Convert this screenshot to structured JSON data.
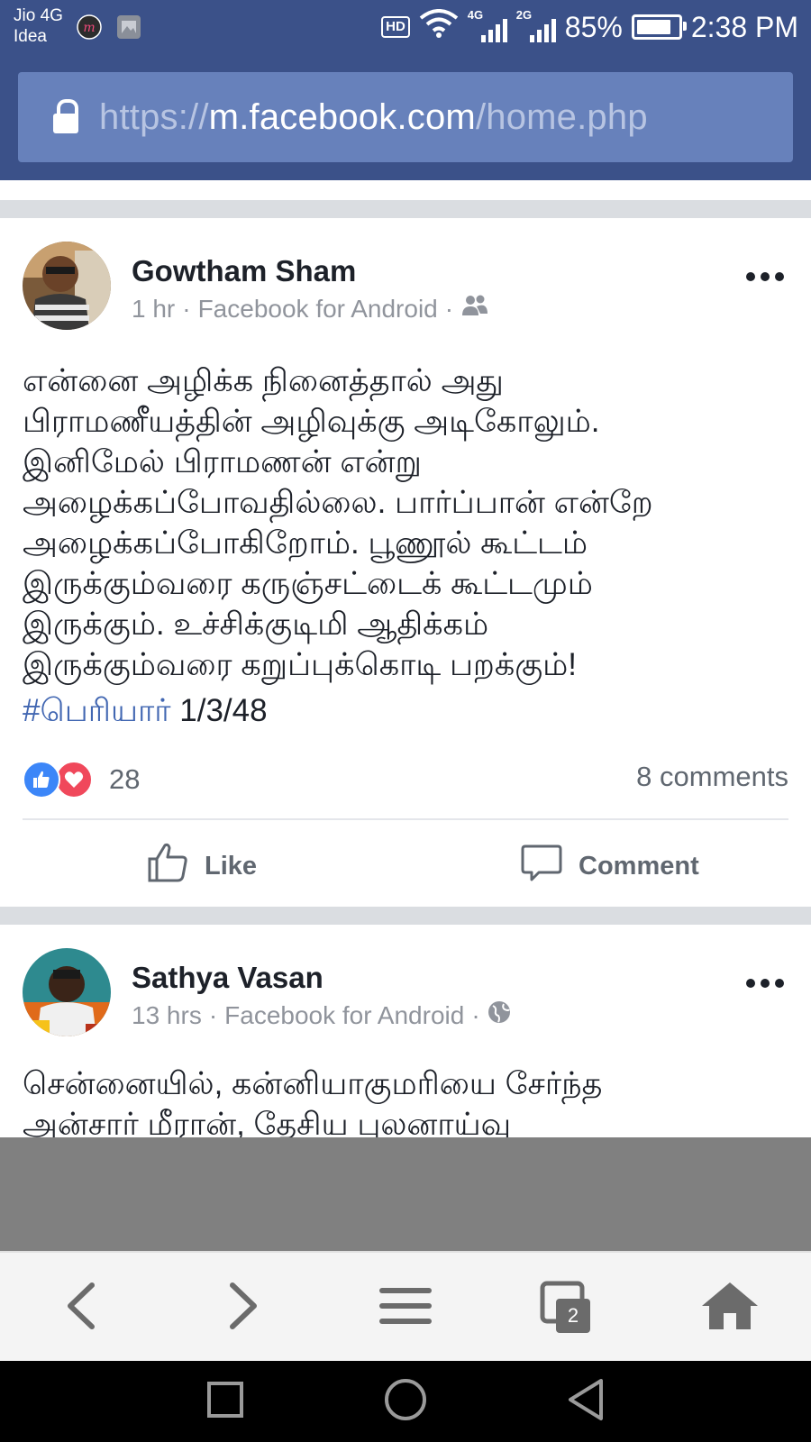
{
  "status_bar": {
    "carrier_line1": "Jio 4G",
    "carrier_line2": "Idea",
    "hd": "HD",
    "sim1_network": "4G",
    "sim2_network": "2G",
    "battery_percent_label": "85%",
    "battery_level": 0.85,
    "time": "2:38 PM",
    "icons": [
      "messenger-icon",
      "gallery-icon",
      "wifi-icon",
      "signal-icon",
      "battery-icon"
    ]
  },
  "browser": {
    "url_scheme": "https://",
    "url_host": "m.facebook.com",
    "url_path": "/home.php",
    "tab_count": "2",
    "accent": "#3b5189"
  },
  "posts": [
    {
      "author": "Gowtham Sham",
      "time": "1 hr",
      "source": "Facebook for Android",
      "audience_icon": "friends-icon",
      "lines": [
        "என்னை அழிக்க நினைத்தால் அது",
        "பிராமணீயத்தின் அழிவுக்கு அடிகோலும்.",
        "இனிமேல் பிராமணன் என்று",
        "அழைக்கப்போவதில்லை. பார்ப்பான் என்றே",
        "அழைக்கப்போகிறோம். பூணூல் கூட்டம்",
        "இருக்கும்வரை கருஞ்சட்டைக் கூட்டமும்",
        "இருக்கும். உச்சிக்குடிமி ஆதிக்கம்",
        "இருக்கும்வரை கறுப்புக்கொடி பறக்கும்!"
      ],
      "hashtag": "#பெரியார்",
      "date_text": "1/3/48",
      "reaction_count": "28",
      "comments": "8 comments",
      "like_label": "Like",
      "comment_label": "Comment"
    },
    {
      "author": "Sathya Vasan",
      "time": "13 hrs",
      "source": "Facebook for Android",
      "audience_icon": "globe-icon",
      "lines": [
        "சென்னையில், கன்னியாகுமரியை சேர்ந்த",
        "அன்சார் மீரான், தேசிய புலனாய்வு"
      ]
    }
  ]
}
